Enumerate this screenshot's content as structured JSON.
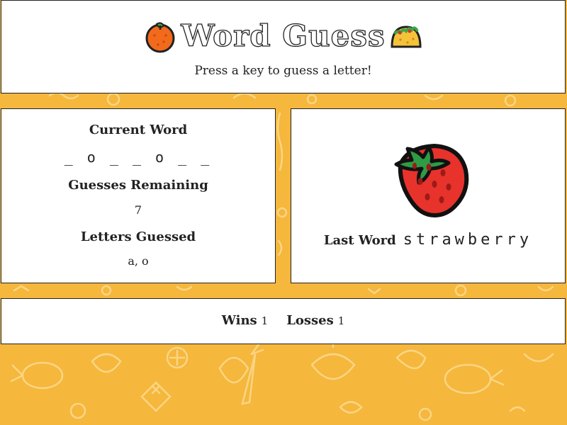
{
  "app": {
    "title": "Word Guess",
    "subtitle": "Press a key to guess a letter!",
    "title_left_icon": "orange-icon",
    "title_right_icon": "taco-icon"
  },
  "game": {
    "current_word_label": "Current Word",
    "current_word_value": "_ o _ _ o _ _",
    "guesses_remaining_label": "Guesses Remaining",
    "guesses_remaining_value": "7",
    "letters_guessed_label": "Letters Guessed",
    "letters_guessed_value": "a, o"
  },
  "last_word": {
    "icon": "strawberry-icon",
    "label": "Last Word",
    "value": "strawberry"
  },
  "score": {
    "wins_label": "Wins",
    "wins_value": "1",
    "losses_label": "Losses",
    "losses_value": "1"
  },
  "colors": {
    "background": "#f5b73c",
    "card": "#ffffff",
    "border": "#222222"
  }
}
